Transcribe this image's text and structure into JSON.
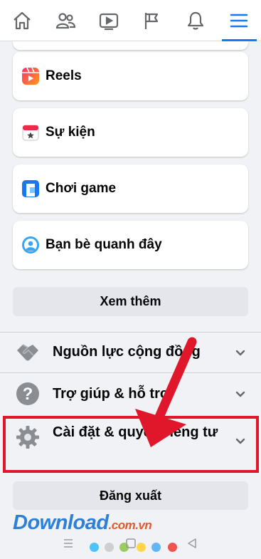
{
  "nav": {
    "tabs": [
      {
        "name": "home-icon"
      },
      {
        "name": "friends-icon"
      },
      {
        "name": "watch-icon"
      },
      {
        "name": "flag-icon"
      },
      {
        "name": "bell-icon"
      },
      {
        "name": "menu-icon",
        "active": true
      }
    ]
  },
  "shortcuts": [
    {
      "label": "Reels",
      "icon": "reels-icon"
    },
    {
      "label": "Sự kiện",
      "icon": "events-icon"
    },
    {
      "label": "Chơi game",
      "icon": "gaming-icon"
    },
    {
      "label": "Bạn bè quanh đây",
      "icon": "nearby-friends-icon"
    }
  ],
  "see_more_label": "Xem thêm",
  "sections": [
    {
      "label": "Nguồn lực cộng đồng",
      "icon": "handshake-icon"
    },
    {
      "label": "Trợ giúp & hỗ trợ",
      "icon": "help-icon"
    },
    {
      "label": "Cài đặt & quyền riêng tư",
      "icon": "settings-gear-icon"
    }
  ],
  "logout_label": "Đăng xuất",
  "watermark": {
    "brand": "Download",
    "tld": ".com.vn"
  },
  "colors": {
    "accent": "#1877f2",
    "annotation_red": "#e0162b",
    "background": "#f0f2f5"
  }
}
